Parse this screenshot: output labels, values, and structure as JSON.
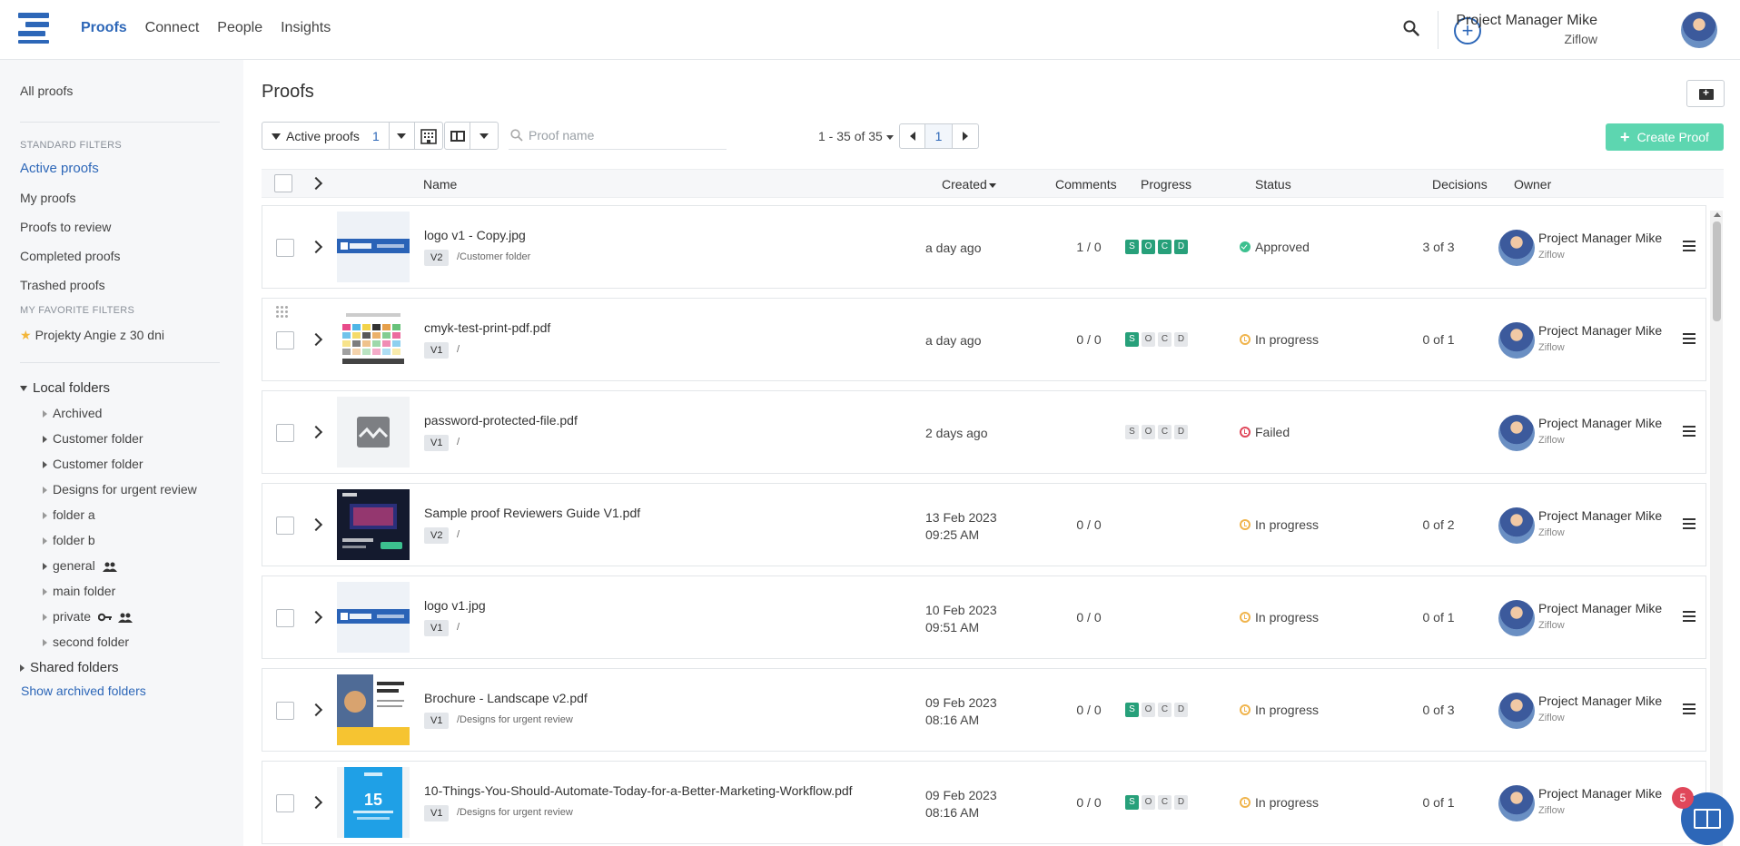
{
  "nav": {
    "links": [
      "Proofs",
      "Connect",
      "People",
      "Insights"
    ],
    "user_name": "Project Manager Mike",
    "user_org": "Ziflow"
  },
  "sidebar": {
    "all_proofs": "All proofs",
    "standard_filters_heading": "STANDARD FILTERS",
    "standard_filters": [
      "Active proofs",
      "My proofs",
      "Proofs to review",
      "Completed proofs",
      "Trashed proofs"
    ],
    "favorite_filters_heading": "MY FAVORITE FILTERS",
    "favorite_filter": "Projekty Angie z 30 dni",
    "local_folders": "Local folders",
    "folders": [
      "Archived",
      "Customer folder",
      "Customer folder",
      "Designs for urgent review",
      "folder a",
      "folder b",
      "general",
      "main folder",
      "private",
      "second folder"
    ],
    "shared_folders": "Shared folders",
    "show_archived": "Show archived folders"
  },
  "main": {
    "title": "Proofs",
    "filter_label": "Active proofs",
    "filter_count": "1",
    "search_placeholder": "Proof name",
    "pager_text": "1 - 35 of 35",
    "current_page": "1",
    "create_label": "Create Proof"
  },
  "table": {
    "headers": {
      "name": "Name",
      "created": "Created",
      "comments": "Comments",
      "progress": "Progress",
      "status": "Status",
      "decisions": "Decisions",
      "owner": "Owner"
    },
    "progress_letters": [
      "S",
      "O",
      "C",
      "D"
    ],
    "rows": [
      {
        "name": "logo v1 - Copy.jpg",
        "version": "V2",
        "path": "/Customer folder",
        "created": "a day ago",
        "comments": "1 / 0",
        "progress": [
          true,
          true,
          true,
          true
        ],
        "status": "Approved",
        "status_kind": "approved",
        "decisions": "3 of 3",
        "owner": "Project Manager Mike",
        "owner_org": "Ziflow",
        "thumb": "logo"
      },
      {
        "name": "cmyk-test-print-pdf.pdf",
        "version": "V1",
        "path": "/",
        "created": "a day ago",
        "comments": "0 / 0",
        "progress": [
          true,
          false,
          false,
          false
        ],
        "status": "In progress",
        "status_kind": "inprog",
        "decisions": "0 of 1",
        "owner": "Project Manager Mike",
        "owner_org": "Ziflow",
        "thumb": "cmyk"
      },
      {
        "name": "password-protected-file.pdf",
        "version": "V1",
        "path": "/",
        "created": "2 days ago",
        "comments": "",
        "progress": [
          false,
          false,
          false,
          false
        ],
        "status": "Failed",
        "status_kind": "failed",
        "decisions": "",
        "owner": "Project Manager Mike",
        "owner_org": "Ziflow",
        "thumb": "broken"
      },
      {
        "name": "Sample proof Reviewers Guide V1.pdf",
        "version": "V2",
        "path": "/",
        "created": "13 Feb 2023\n09:25 AM",
        "comments": "0 / 0",
        "progress": null,
        "status": "In progress",
        "status_kind": "inprog",
        "decisions": "0 of 2",
        "owner": "Project Manager Mike",
        "owner_org": "Ziflow",
        "thumb": "guide"
      },
      {
        "name": "logo v1.jpg",
        "version": "V1",
        "path": "/",
        "created": "10 Feb 2023\n09:51 AM",
        "comments": "0 / 0",
        "progress": null,
        "status": "In progress",
        "status_kind": "inprog",
        "decisions": "0 of 1",
        "owner": "Project Manager Mike",
        "owner_org": "Ziflow",
        "thumb": "logo"
      },
      {
        "name": "Brochure - Landscape v2.pdf",
        "version": "V1",
        "path": "/Designs for urgent review",
        "created": "09 Feb 2023\n08:16 AM",
        "comments": "0 / 0",
        "progress": [
          true,
          false,
          false,
          false
        ],
        "status": "In progress",
        "status_kind": "inprog",
        "decisions": "0 of 3",
        "owner": "Project Manager Mike",
        "owner_org": "Ziflow",
        "thumb": "brochure"
      },
      {
        "name": "10-Things-You-Should-Automate-Today-for-a-Better-Marketing-Workflow.pdf",
        "version": "V1",
        "path": "/Designs for urgent review",
        "created": "09 Feb 2023\n08:16 AM",
        "comments": "0 / 0",
        "progress": [
          true,
          false,
          false,
          false
        ],
        "status": "In progress",
        "status_kind": "inprog",
        "decisions": "0 of 1",
        "owner": "Project Manager Mike",
        "owner_org": "Ziflow",
        "thumb": "ten"
      }
    ]
  },
  "help_badge": "5"
}
